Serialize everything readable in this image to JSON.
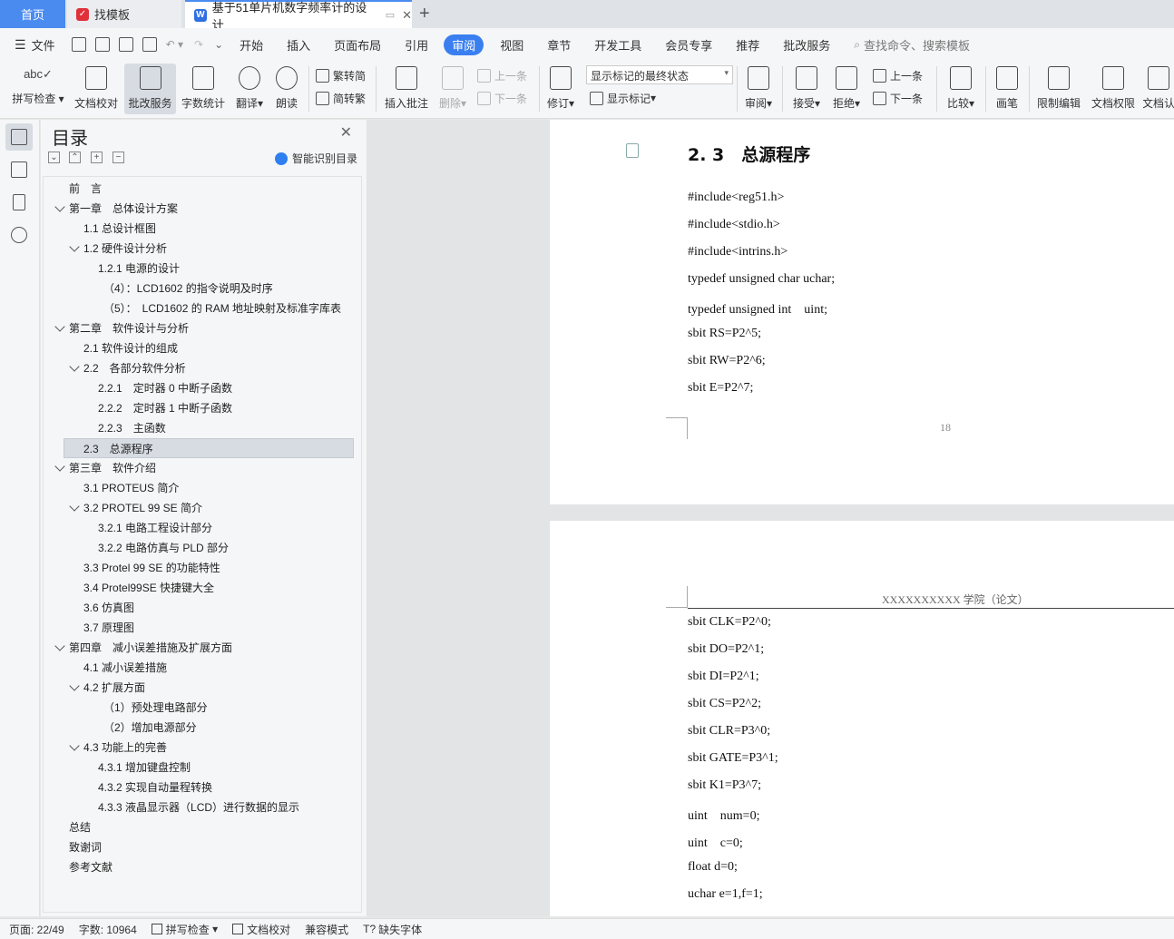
{
  "tabs": {
    "home": "首页",
    "template": "找模板",
    "document": "基于51单片机数字频率计的设计"
  },
  "menu": {
    "file": "文件",
    "items": [
      "开始",
      "插入",
      "页面布局",
      "引用",
      "审阅",
      "视图",
      "章节",
      "开发工具",
      "会员专享",
      "推荐",
      "批改服务"
    ],
    "active_index": 4,
    "search": "查找命令、搜索模板"
  },
  "ribbon": {
    "spellcheck": "拼写检查",
    "doc_proof": "文档校对",
    "correction": "批改服务",
    "word_count": "字数统计",
    "translate": "翻译",
    "read_aloud": "朗读",
    "to_traditional": "繁转简",
    "to_simplified": "简转繁",
    "insert_comment": "插入批注",
    "delete": "删除",
    "prev_comment": "上一条",
    "next_comment": "下一条",
    "revise": "修订",
    "markup_state": "显示标记的最终状态",
    "show_markup": "显示标记",
    "review": "审阅",
    "accept": "接受",
    "reject": "拒绝",
    "prev_change": "上一条",
    "next_change": "下一条",
    "compare": "比较",
    "pen": "画笔",
    "restrict_edit": "限制编辑",
    "doc_permission": "文档权限",
    "doc_verify": "文档认"
  },
  "toc": {
    "title": "目录",
    "smart": "智能识别目录",
    "items": [
      {
        "text": "前　言",
        "level": 0,
        "caret": false
      },
      {
        "text": "第一章　总体设计方案",
        "level": 0,
        "caret": true
      },
      {
        "text": "1.1 总设计框图",
        "level": 1,
        "caret": false
      },
      {
        "text": "1.2 硬件设计分析",
        "level": 1,
        "caret": true
      },
      {
        "text": "1.2.1 电源的设计",
        "level": 2,
        "caret": false
      },
      {
        "text": "（4）：LCD1602 的指令说明及时序",
        "level": 3,
        "caret": false
      },
      {
        "text": "（5）：　LCD1602 的 RAM 地址映射及标准字库表",
        "level": 3,
        "caret": false
      },
      {
        "text": "第二章　软件设计与分析",
        "level": 0,
        "caret": true
      },
      {
        "text": "2.1 软件设计的组成",
        "level": 1,
        "caret": false
      },
      {
        "text": "2.2　各部分软件分析",
        "level": 1,
        "caret": true
      },
      {
        "text": "2.2.1　定时器 0 中断子函数",
        "level": 2,
        "caret": false
      },
      {
        "text": "2.2.2　定时器 1 中断子函数",
        "level": 2,
        "caret": false
      },
      {
        "text": "2.2.3　主函数",
        "level": 2,
        "caret": false
      },
      {
        "text": "2.3　总源程序",
        "level": 1,
        "caret": false,
        "selected": true
      },
      {
        "text": "第三章　软件介绍",
        "level": 0,
        "caret": true
      },
      {
        "text": "3.1 PROTEUS 简介",
        "level": 1,
        "caret": false
      },
      {
        "text": "3.2 PROTEL 99 SE 简介",
        "level": 1,
        "caret": true
      },
      {
        "text": "3.2.1 电路工程设计部分",
        "level": 2,
        "caret": false
      },
      {
        "text": "3.2.2 电路仿真与 PLD 部分",
        "level": 2,
        "caret": false
      },
      {
        "text": "3.3 Protel 99 SE 的功能特性",
        "level": 1,
        "caret": false
      },
      {
        "text": "3.4 Protel99SE 快捷键大全",
        "level": 1,
        "caret": false
      },
      {
        "text": "3.6 仿真图",
        "level": 1,
        "caret": false
      },
      {
        "text": "3.7 原理图",
        "level": 1,
        "caret": false
      },
      {
        "text": "第四章　减小误差措施及扩展方面",
        "level": 0,
        "caret": true
      },
      {
        "text": "4.1 减小误差措施",
        "level": 1,
        "caret": false
      },
      {
        "text": "4.2 扩展方面",
        "level": 1,
        "caret": true
      },
      {
        "text": "（1）预处理电路部分",
        "level": 3,
        "caret": false
      },
      {
        "text": "（2）增加电源部分",
        "level": 3,
        "caret": false
      },
      {
        "text": "4.3 功能上的完善",
        "level": 1,
        "caret": true
      },
      {
        "text": "4.3.1 增加键盘控制",
        "level": 2,
        "caret": false
      },
      {
        "text": "4.3.2 实现自动量程转换",
        "level": 2,
        "caret": false
      },
      {
        "text": "4.3.3 液晶显示器（LCD）进行数据的显示",
        "level": 2,
        "caret": false
      },
      {
        "text": "总结",
        "level": 0,
        "caret": false
      },
      {
        "text": "致谢词",
        "level": 0,
        "caret": false
      },
      {
        "text": "参考文献",
        "level": 0,
        "caret": false
      }
    ]
  },
  "document": {
    "heading": "2. 3　总源程序",
    "page1_code": [
      "#include<reg51.h>",
      "#include<stdio.h>",
      "#include<intrins.h>",
      "typedef unsigned char uchar;",
      "typedef unsigned int　uint;",
      "sbit RS=P2^5;",
      "sbit RW=P2^6;",
      "sbit E=P2^7;"
    ],
    "page_number": "18",
    "header_text": "XXXXXXXXXX 学院（论文）",
    "page2_code": [
      "sbit CLK=P2^0;",
      "sbit DO=P2^1;",
      "sbit DI=P2^1;",
      "sbit CS=P2^2;",
      "sbit CLR=P3^0;",
      "sbit GATE=P3^1;",
      "sbit K1=P3^7;",
      "uint　num=0;",
      "uint　c=0;",
      "float d=0;",
      "uchar e=1,f=1;"
    ]
  },
  "status": {
    "page": "页面: 22/49",
    "words": "字数: 10964",
    "spell": "拼写检查",
    "proof": "文档校对",
    "compat": "兼容模式",
    "missing_font": "缺失字体"
  },
  "colors": {
    "accent": "#3a7ff0",
    "home_tab": "#4a8bf0"
  }
}
